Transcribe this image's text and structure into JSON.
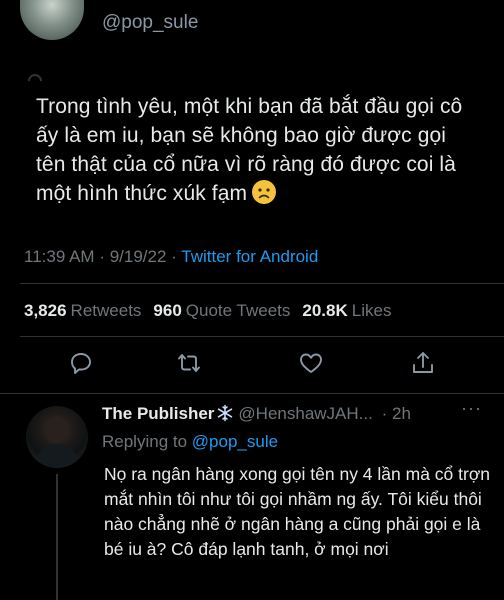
{
  "tweet": {
    "author_handle": "@pop_sule",
    "text": "Trong tình yêu, một khi bạn đã bắt đầu gọi cô ấy là em iu, bạn sẽ không bao giờ được gọi tên thật của cổ nữa  vì rõ ràng đó được coi là một hình thức xúk fạm",
    "emoji": "slightly-frowning-face-icon",
    "time": "11:39 AM",
    "separator": "·",
    "date": "9/19/22",
    "source": "Twitter for Android",
    "stats": {
      "retweets_count": "3,826",
      "retweets_label": "Retweets",
      "quotes_count": "960",
      "quotes_label": "Quote Tweets",
      "likes_count": "20.8K",
      "likes_label": "Likes"
    }
  },
  "reply": {
    "name": "The Publisher",
    "name_emoji": "snowflake-icon",
    "handle": "@HenshawJAH...",
    "time_separator": "·",
    "time": "2h",
    "more": "···",
    "replying_prefix": "Replying to",
    "replying_to": "@pop_sule",
    "text": "Nọ ra ngân hàng xong gọi tên ny 4 lần mà cổ trợn mắt nhìn tôi như tôi gọi nhầm ng ấy. Tôi kiểu thôi nào chẳng nhẽ ở ngân hàng a cũng phải gọi e là bé iu à? Cô đáp lạnh tanh, ở mọi nơi"
  },
  "colors": {
    "background": "#000000",
    "text": "#e7e9ea",
    "muted": "#71767b",
    "accent": "#1d9bf0",
    "divider": "#2f3336"
  }
}
